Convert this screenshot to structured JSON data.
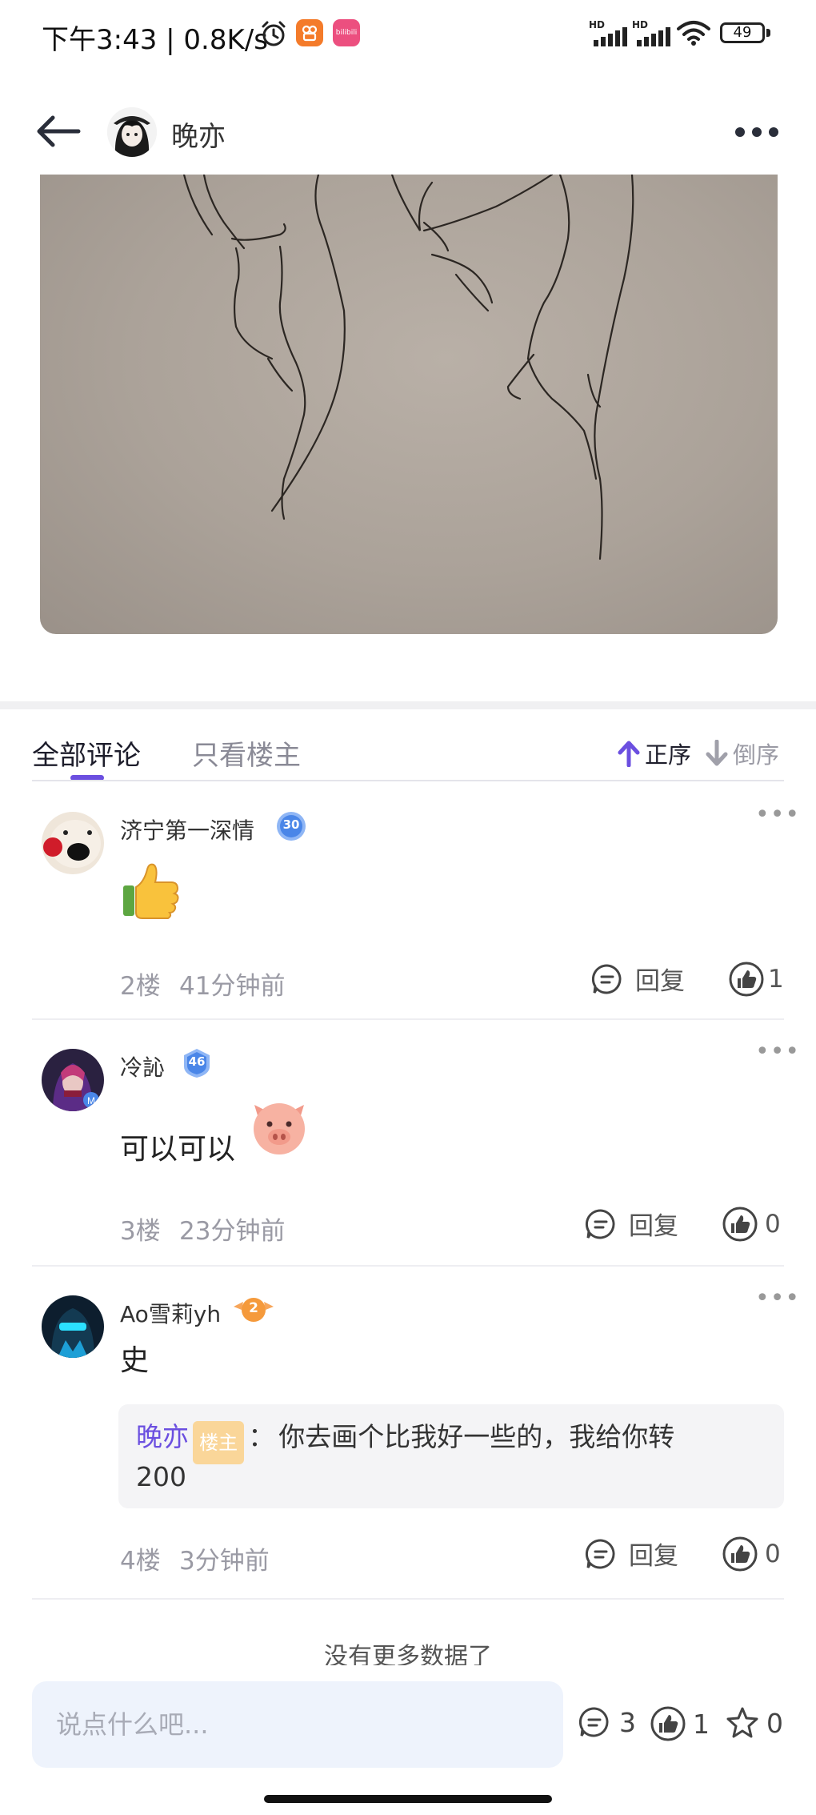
{
  "status_bar": {
    "time_speed": "下午3:43 | 0.8K/s",
    "battery": "49",
    "signal_label_1": "HD",
    "signal_label_2": "HD",
    "app_badge_bilibili": "bilibili"
  },
  "header": {
    "author": "晚亦"
  },
  "tabs": {
    "all_comments": "全部评论",
    "only_host": "只看楼主",
    "sort_asc": "正序",
    "sort_desc": "倒序"
  },
  "comments": [
    {
      "name": "济宁第一深情",
      "level": "30",
      "text": "",
      "floor": "2楼",
      "time": "41分钟前",
      "reply_label": "回复",
      "likes": "1"
    },
    {
      "name": "冷訫",
      "level": "46",
      "text": "可以可以",
      "floor": "3楼",
      "time": "23分钟前",
      "reply_label": "回复",
      "likes": "0"
    },
    {
      "name": "Ao雪莉yh",
      "level": "2",
      "text": "史",
      "floor": "4楼",
      "time": "3分钟前",
      "reply_label": "回复",
      "likes": "0",
      "sub_reply": {
        "author": "晚亦",
        "tag": "楼主",
        "separator": "：",
        "text": "你去画个比我好一些的，我给你转",
        "text_line2": "200"
      }
    }
  ],
  "no_more": "没有更多数据了",
  "bottom_bar": {
    "placeholder": "说点什么吧...",
    "comment_count": "3",
    "like_count": "1",
    "star_count": "0"
  },
  "colors": {
    "accent": "#6b4fe0",
    "host_tag": "#fad699",
    "input_bg": "#eef3fc"
  }
}
